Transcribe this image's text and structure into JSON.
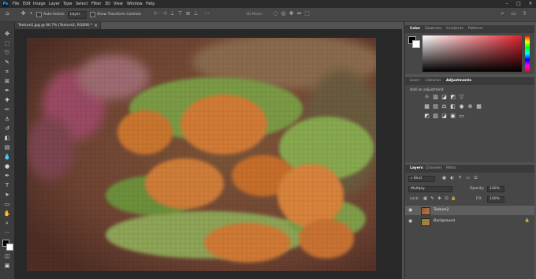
{
  "menu": {
    "logo": "Ps",
    "items": [
      "File",
      "Edit",
      "Image",
      "Layer",
      "Type",
      "Select",
      "Filter",
      "3D",
      "View",
      "Window",
      "Help"
    ],
    "window_controls": {
      "minimize": "–",
      "maximize": "□",
      "close": "×"
    }
  },
  "options_bar": {
    "auto_select_label": "Auto-Select:",
    "auto_select_value": "Layer",
    "show_transform_label": "Show Transform Controls",
    "mode_3d_label": "3D Mode:"
  },
  "document": {
    "tab_title": "Texture1.jpg @ 66.7% (Texture2, RGB/8) *",
    "tab_close": "×"
  },
  "color_panel": {
    "tabs": [
      "Color",
      "Swatches",
      "Gradients",
      "Patterns"
    ],
    "active_tab": "Color",
    "hue_color": "#e0232e"
  },
  "adjustments_panel": {
    "tabs": [
      "Learn",
      "Libraries",
      "Adjustments"
    ],
    "active_tab": "Adjustments",
    "add_label": "Add an adjustment",
    "row1_icons": [
      "brightness-icon",
      "levels-icon",
      "curves-icon",
      "exposure-icon",
      "triangle-icon"
    ],
    "row2_icons": [
      "vibrance-icon",
      "hue-sat-icon",
      "color-balance-icon",
      "bw-icon",
      "photo-filter-icon",
      "channel-mixer-icon",
      "color-lookup-icon"
    ],
    "row3_icons": [
      "invert-icon",
      "posterize-icon",
      "threshold-icon",
      "selective-color-icon",
      "gradient-map-icon"
    ]
  },
  "layers_panel": {
    "tabs": [
      "Layers",
      "Channels",
      "Paths"
    ],
    "active_tab": "Layers",
    "kind_label": "Kind",
    "blend_mode": "Multiply",
    "opacity_label": "Opacity:",
    "opacity_value": "100%",
    "lock_label": "Lock:",
    "fill_label": "Fill:",
    "fill_value": "100%",
    "layers": [
      {
        "name": "Texture2",
        "selected": true
      },
      {
        "name": "Background",
        "selected": false
      }
    ]
  }
}
